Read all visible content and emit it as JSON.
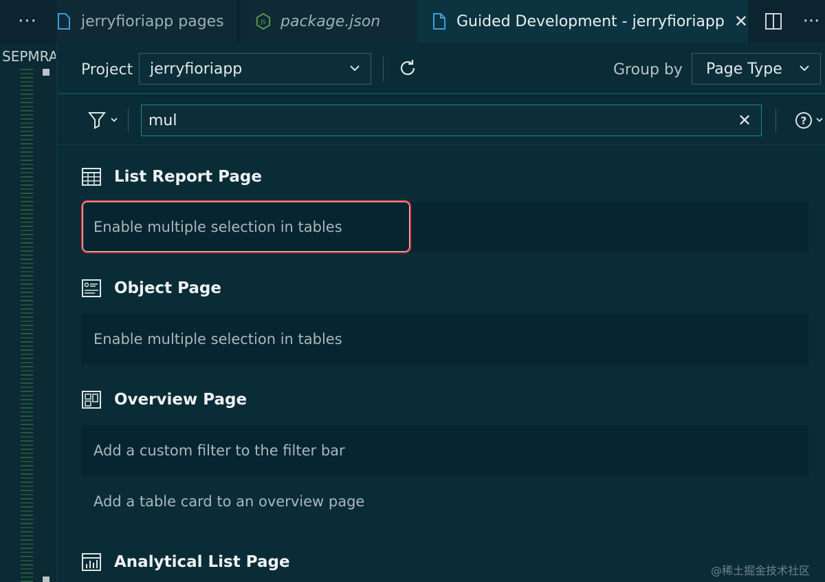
{
  "tabs": {
    "more": "···",
    "items": [
      {
        "label": "jerryfioriapp pages"
      },
      {
        "label": "package.json"
      },
      {
        "label": "Guided Development - jerryfioriapp"
      }
    ],
    "close": "✕",
    "more_right": "···"
  },
  "explorer": {
    "title": "SEPMRA"
  },
  "toolbar": {
    "project_label": "Project",
    "project_value": "jerryfioriapp",
    "group_by_label": "Group by",
    "group_by_value": "Page Type"
  },
  "search": {
    "value": "mul",
    "clear": "✕"
  },
  "sections": [
    {
      "title": "List Report Page",
      "icon": "list-report-icon",
      "items": [
        "Enable multiple selection in tables"
      ]
    },
    {
      "title": "Object Page",
      "icon": "object-page-icon",
      "items": [
        "Enable multiple selection in tables"
      ]
    },
    {
      "title": "Overview Page",
      "icon": "overview-page-icon",
      "items": [
        "Add a custom filter to the filter bar",
        "Add a table card to an overview page"
      ]
    },
    {
      "title": "Analytical List Page",
      "icon": "analytical-list-icon",
      "items": []
    }
  ],
  "watermark": "@稀土掘金技术社区",
  "colors": {
    "background": "#0a2c36",
    "highlight": "#e23a3f",
    "search_border": "#1c8a8e",
    "row_shade": "#072530"
  }
}
